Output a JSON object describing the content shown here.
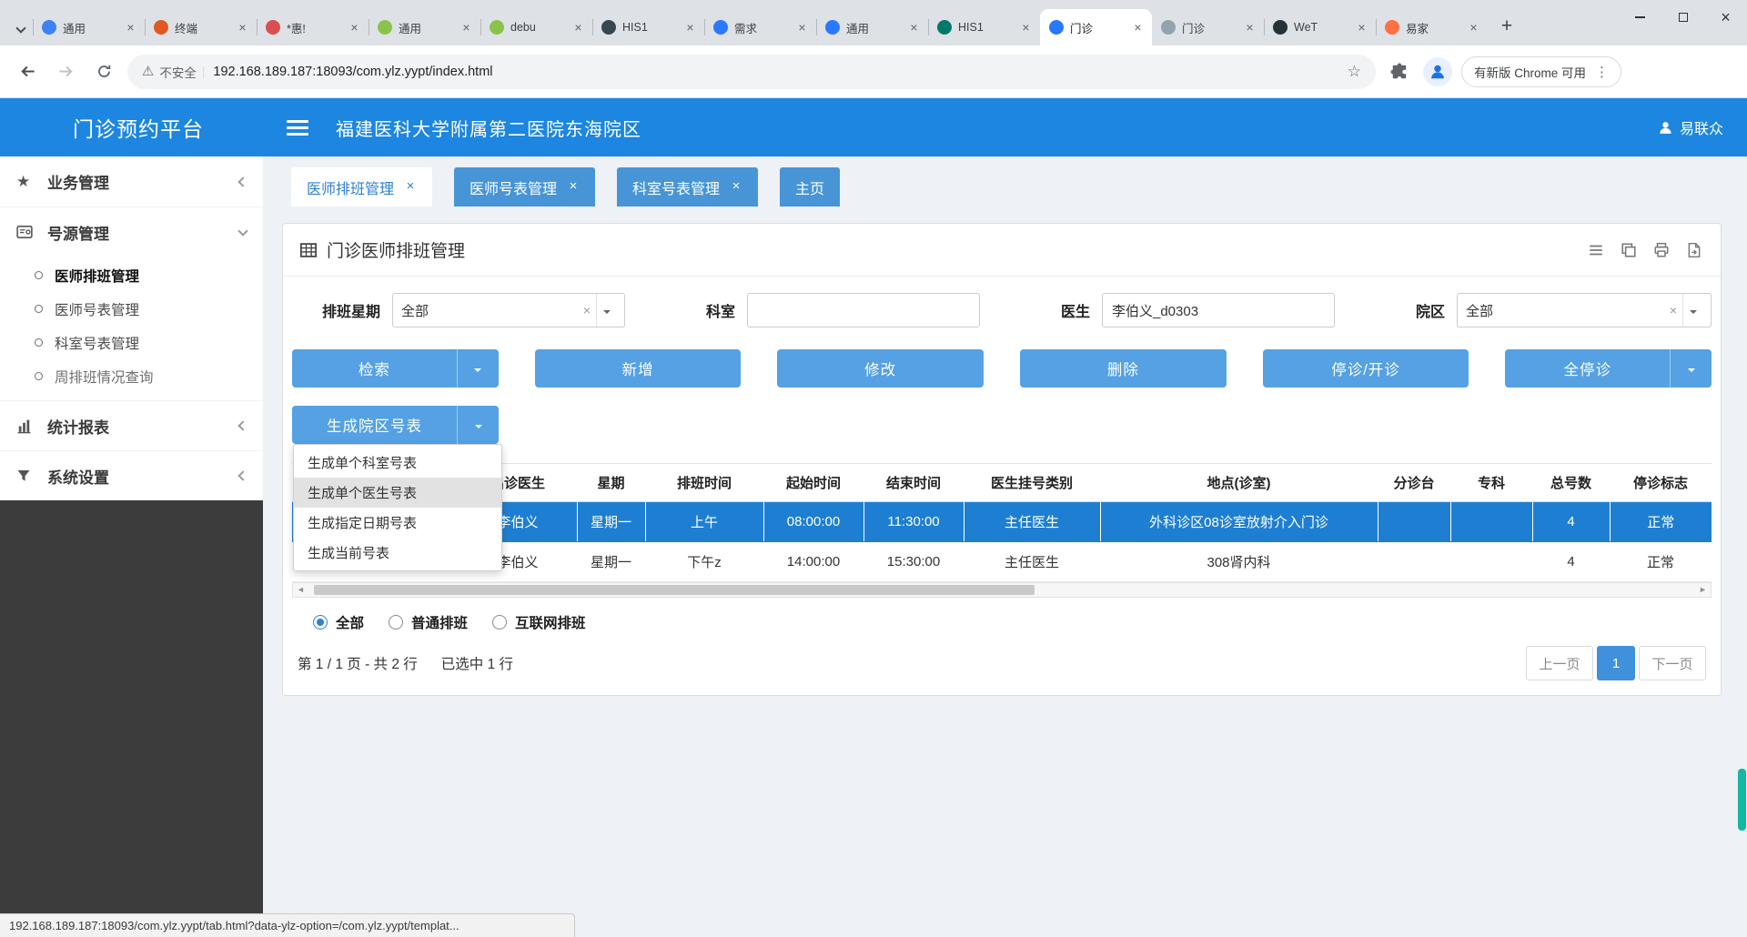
{
  "browser": {
    "tabs": [
      {
        "label": "通用",
        "favicon": "#3b82f6"
      },
      {
        "label": "终端",
        "favicon": "#e25822"
      },
      {
        "label": "*惠!",
        "favicon": "#d94f4f"
      },
      {
        "label": "通用",
        "favicon": "#8bc34a"
      },
      {
        "label": "debu",
        "favicon": "#8bc34a"
      },
      {
        "label": "HIS1",
        "favicon": "#37474f"
      },
      {
        "label": "需求",
        "favicon": "#2979ff"
      },
      {
        "label": "通用",
        "favicon": "#2979ff"
      },
      {
        "label": "HIS1",
        "favicon": "#00796b"
      },
      {
        "label": "门诊",
        "favicon": "#2979ff"
      },
      {
        "label": "门诊",
        "favicon": "#90a4ae"
      },
      {
        "label": "WeT",
        "favicon": "#263238"
      },
      {
        "label": "易家",
        "favicon": "#ff7043"
      }
    ],
    "address": {
      "security_text": "不安全",
      "url": "192.168.189.187:18093/com.ylz.yypt/index.html",
      "update_chip": "有新版 Chrome 可用"
    }
  },
  "app_header": {
    "title": "门诊预约平台",
    "hospital": "福建医科大学附属第二医院东海院区",
    "user": "易联众"
  },
  "sidebar": {
    "group1": "业务管理",
    "group2": "号源管理",
    "group2_items": [
      "医师排班管理",
      "医师号表管理",
      "科室号表管理",
      "周排班情况查询"
    ],
    "group3": "统计报表",
    "group4": "系统设置"
  },
  "workspace": {
    "tabs": [
      "医师排班管理",
      "医师号表管理",
      "科室号表管理",
      "主页"
    ],
    "panel_title": "门诊医师排班管理",
    "filters": {
      "week_label": "排班星期",
      "week_value": "全部",
      "dept_label": "科室",
      "dept_value": "",
      "doctor_label": "医生",
      "doctor_value": "李伯义_d0303",
      "campus_label": "院区",
      "campus_value": "全部"
    },
    "buttons": [
      "检索",
      "新增",
      "修改",
      "删除",
      "停诊/开诊",
      "全停诊"
    ],
    "generate_button": "生成院区号表",
    "menu_items": [
      "生成单个科室号表",
      "生成单个医生号表",
      "生成指定日期号表",
      "生成当前号表"
    ],
    "table": {
      "columns": [
        "",
        "出诊医生",
        "星期",
        "排班时间",
        "起始时间",
        "结束时间",
        "医生挂号类别",
        "地点(诊室)",
        "分诊台",
        "专科",
        "总号数",
        "停诊标志"
      ],
      "rows": [
        [
          "",
          "李伯义",
          "星期一",
          "上午",
          "08:00:00",
          "11:30:00",
          "主任医生",
          "外科诊区08诊室放射介入门诊",
          "",
          "",
          "4",
          "正常"
        ],
        [
          "",
          "李伯义",
          "星期一",
          "下午z",
          "14:00:00",
          "15:30:00",
          "主任医生",
          "308肾内科",
          "",
          "",
          "4",
          "正常"
        ]
      ]
    },
    "radios": [
      "全部",
      "普通排班",
      "互联网排班"
    ],
    "pagination": {
      "summary": "第 1 / 1 页 - 共 2 行",
      "selected_info": "已选中 1 行",
      "prev": "上一页",
      "page": "1",
      "next": "下一页"
    }
  },
  "status_bar": {
    "text": "192.168.189.187:18093/com.ylz.yypt/tab.html?data-ylz-option=/com.ylz.yypt/templat..."
  },
  "colors": {
    "header_blue": "#1d86e0",
    "tab_blue": "#4795d6",
    "button_blue": "#55a1e3",
    "selected_row_blue": "#1e7fd2",
    "pager_active_blue": "#3f91dc",
    "scroll_thumb_teal": "#12b8a2"
  }
}
